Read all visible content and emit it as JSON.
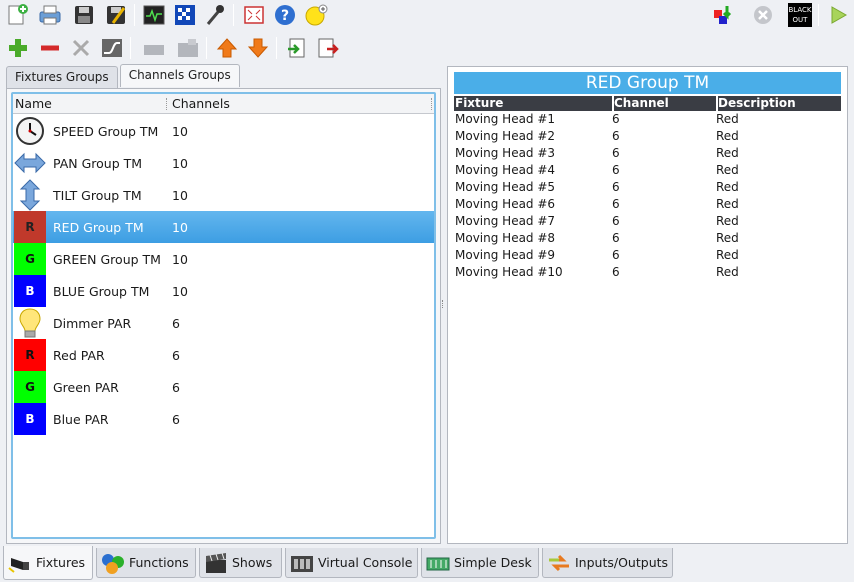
{
  "toolbar": {
    "top_left": [
      {
        "icon": "new-document-icon"
      },
      {
        "icon": "print-icon"
      },
      {
        "icon": "save-icon"
      },
      {
        "icon": "save-as-icon"
      },
      {
        "icon": "monitor-icon"
      },
      {
        "icon": "address-tool-icon"
      },
      {
        "icon": "wand-icon"
      },
      {
        "icon": "fullscreen-icon"
      },
      {
        "icon": "help-icon"
      },
      {
        "icon": "about-icon"
      }
    ],
    "top_right": [
      {
        "icon": "fixture-refresh-icon"
      },
      {
        "icon": "stop-icon"
      },
      {
        "icon": "blackout-icon",
        "label_line1": "BLACK",
        "label_line2": "OUT"
      },
      {
        "icon": "play-icon"
      }
    ],
    "second": [
      {
        "icon": "add-icon"
      },
      {
        "icon": "remove-icon"
      },
      {
        "icon": "tools-icon"
      },
      {
        "icon": "curve-icon"
      },
      {
        "icon": "group-icon"
      },
      {
        "icon": "folder-icon"
      },
      {
        "icon": "arrow-up-icon"
      },
      {
        "icon": "arrow-down-icon"
      },
      {
        "icon": "import-icon"
      },
      {
        "icon": "export-icon"
      }
    ]
  },
  "left_tabs": [
    "Fixtures Groups",
    "Channels Groups"
  ],
  "tree": {
    "col_name": "Name",
    "col_channels": "Channels",
    "rows": [
      {
        "name": "SPEED Group TM",
        "channels": "10",
        "icon": "clock-icon"
      },
      {
        "name": "PAN Group TM",
        "channels": "10",
        "icon": "pan-arrow-icon"
      },
      {
        "name": "TILT Group TM",
        "channels": "10",
        "icon": "tilt-arrow-icon"
      },
      {
        "name": "RED Group TM",
        "channels": "10",
        "icon": "red-square-icon",
        "letter": "R",
        "color": "#c0392b"
      },
      {
        "name": "GREEN Group TM",
        "channels": "10",
        "icon": "green-square-icon",
        "letter": "G",
        "color": "#00ff00"
      },
      {
        "name": "BLUE Group TM",
        "channels": "10",
        "icon": "blue-square-icon",
        "letter": "B",
        "color": "#0000ff"
      },
      {
        "name": "Dimmer PAR",
        "channels": "6",
        "icon": "bulb-icon"
      },
      {
        "name": "Red PAR",
        "channels": "6",
        "icon": "red-square-icon",
        "letter": "R",
        "color": "#ff0000"
      },
      {
        "name": "Green PAR",
        "channels": "6",
        "icon": "green-square-icon",
        "letter": "G",
        "color": "#00ff00"
      },
      {
        "name": "Blue PAR",
        "channels": "6",
        "icon": "blue-square-icon",
        "letter": "B",
        "color": "#0000ff"
      }
    ]
  },
  "detail": {
    "title": "RED Group TM",
    "headers": [
      "Fixture",
      "Channel",
      "Description"
    ],
    "rows": [
      [
        "Moving Head #1",
        "6",
        "Red"
      ],
      [
        "Moving Head #2",
        "6",
        "Red"
      ],
      [
        "Moving Head #3",
        "6",
        "Red"
      ],
      [
        "Moving Head #4",
        "6",
        "Red"
      ],
      [
        "Moving Head #5",
        "6",
        "Red"
      ],
      [
        "Moving Head #6",
        "6",
        "Red"
      ],
      [
        "Moving Head #7",
        "6",
        "Red"
      ],
      [
        "Moving Head #8",
        "6",
        "Red"
      ],
      [
        "Moving Head #9",
        "6",
        "Red"
      ],
      [
        "Moving Head #10",
        "6",
        "Red"
      ]
    ]
  },
  "bottom_tabs": [
    {
      "label": "Fixtures",
      "icon": "fixtures-icon"
    },
    {
      "label": "Functions",
      "icon": "functions-icon"
    },
    {
      "label": "Shows",
      "icon": "shows-icon"
    },
    {
      "label": "Virtual Console",
      "icon": "virtual-console-icon"
    },
    {
      "label": "Simple Desk",
      "icon": "simple-desk-icon"
    },
    {
      "label": "Inputs/Outputs",
      "icon": "inputs-outputs-icon"
    }
  ],
  "colors": {
    "selection": "#3d9ee3",
    "title_bar": "#4aaee8",
    "header_dark": "#3a3d44"
  }
}
